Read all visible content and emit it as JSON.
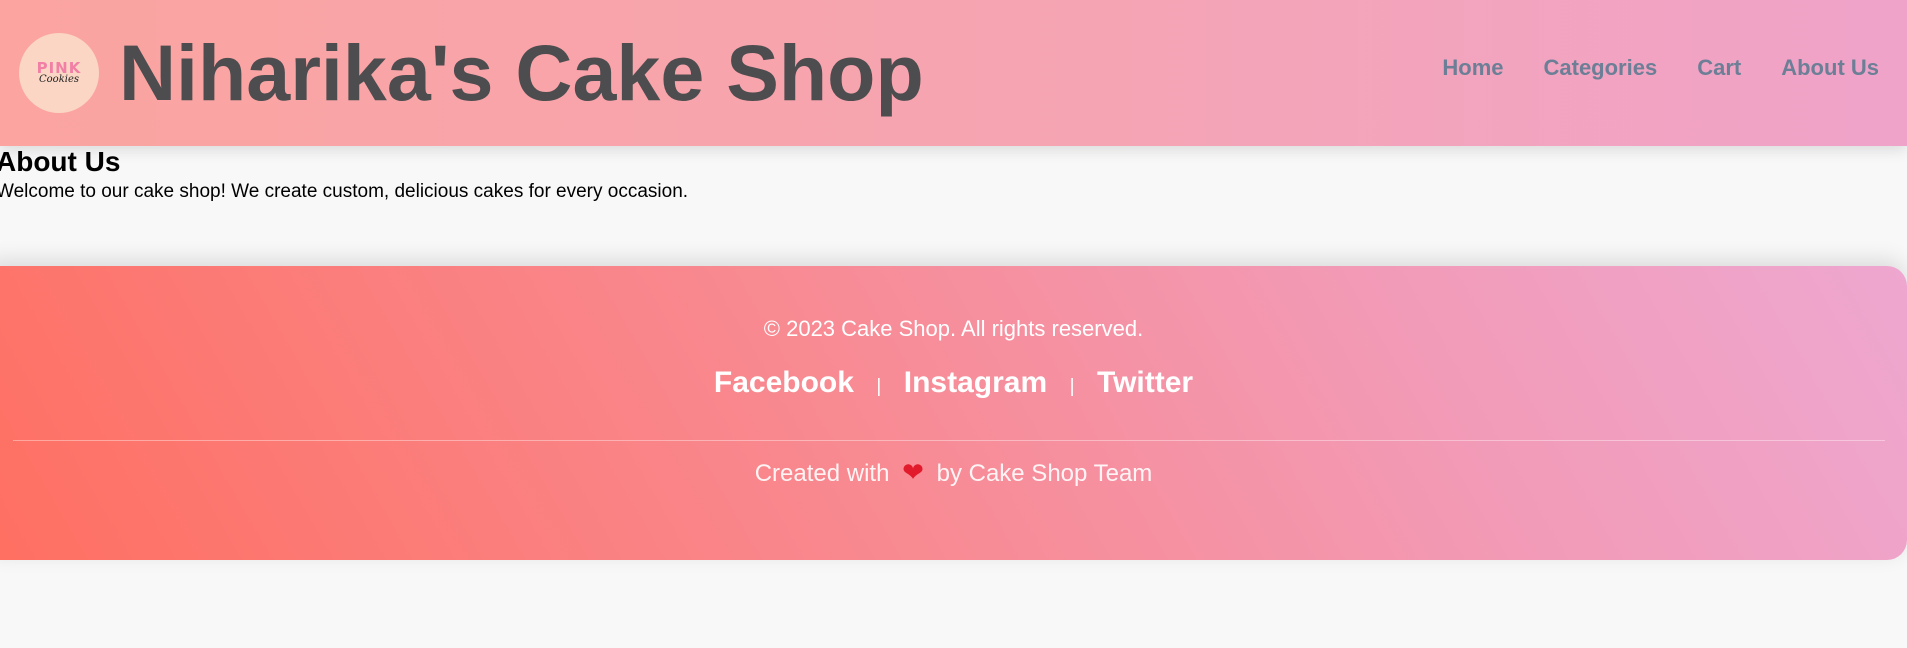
{
  "header": {
    "logo": {
      "top_text": "PINK",
      "bottom_text": "Cookies"
    },
    "title": "Niharika's Cake Shop",
    "nav": [
      {
        "label": "Home"
      },
      {
        "label": "Categories"
      },
      {
        "label": "Cart"
      },
      {
        "label": "About Us"
      }
    ]
  },
  "main": {
    "heading": "About Us",
    "text": "Welcome to our cake shop! We create custom, delicious cakes for every occasion."
  },
  "footer": {
    "copyright": "© 2023 Cake Shop. All rights reserved.",
    "social": [
      {
        "label": "Facebook"
      },
      {
        "label": "Instagram"
      },
      {
        "label": "Twitter"
      }
    ],
    "separator": "|",
    "credit_prefix": "Created with",
    "credit_icon": "heart-icon",
    "credit_suffix": "by Cake Shop Team"
  },
  "colors": {
    "header_gradient_start": "#fba4a0",
    "header_gradient_end": "#f0a3c9",
    "footer_gradient_start": "#ff6f61",
    "footer_gradient_end": "#eea7d0",
    "title_color": "#4d4d4f",
    "nav_color": "#6c7f96",
    "heart_color": "#e21b2c"
  }
}
